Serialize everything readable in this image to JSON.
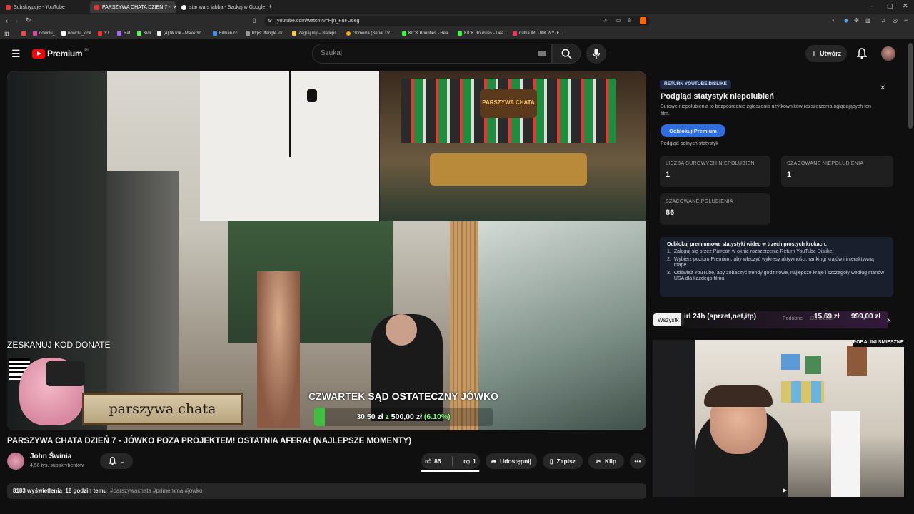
{
  "browser": {
    "tabs": [
      {
        "label": "Subskrypcje - YouTube",
        "active": false
      },
      {
        "label": "PARSZYWA CHATA DZIEŃ 7 -",
        "active": true
      },
      {
        "label": "star wars jabba - Szukaj w Google",
        "active": false
      }
    ],
    "url": "youtube.com/watch?v=Hjn_FuFU6eg",
    "bookmarks": [
      "nowciu_",
      "nowciu_kick",
      "YT",
      "Rat",
      "Kick",
      "(4)TikTok - Make Yo...",
      "Filman.cc",
      "https://tangle.io/",
      "Zagraj.my – Najleps...",
      "Gomorra (Serial TV...",
      "KICK Bounties - Hea...",
      "KICK Bounties - Dea...",
      "nutka IRL JAK WYJE..."
    ]
  },
  "header": {
    "logo_text": "Premium",
    "region": "PL",
    "search_placeholder": "Szukaj",
    "create_label": "Utwórz"
  },
  "video": {
    "overlay_qr_text": "ZESKANUJ KOD DONATE",
    "sign_text": "parszywa chata",
    "caption": "CZWARTEK SĄD OSTATECZNY JÓWKO",
    "donation_current": "30,50 zł",
    "donation_sep": "z",
    "donation_goal": "500,00 zł",
    "donation_pct": "(6.10%)",
    "progress_fraction": 0.061,
    "poster_text": "PARSZYWA CHATA"
  },
  "title": "PARSZYWA CHATA DZIEŃ 7 - JÓWKO POZA PROJEKTEM! OSTATNIA AFERA! (NAJLEPSZE MOMENTY)",
  "channel": {
    "name": "John Świnia",
    "subs": "4,56 tys. subskrybentów"
  },
  "actions": {
    "likes": "85",
    "dislikes": "1",
    "share": "Udostępnij",
    "save": "Zapisz",
    "clip": "Klip"
  },
  "description": {
    "views": "8183 wyświetlenia",
    "time": "18 godzin temu",
    "tags": "#parszywachata #primemma #jówko"
  },
  "panel": {
    "badge": "RETURN YOUTUBE DISLIKE",
    "heading": "Podgląd statystyk niepolubień",
    "subtext": "Surowe niepolubienia to bezpośrednie zgłoszenia użytkowników rozszerzenia oglądających ten film.",
    "unlock_button": "Odblokuj Premium",
    "full_stats_link": "Podgląd pełnych statystyk",
    "stats": [
      {
        "label": "LICZBA SUROWYCH NIEPOLUBIEŃ",
        "value": "1"
      },
      {
        "label": "SZACOWANE NIEPOLUBIENIA",
        "value": "1"
      },
      {
        "label": "SZACOWANE POLUBIENIA",
        "value": "86"
      }
    ],
    "promo_heading": "Odblokuj premiumowe statystyki wideo w trzech prostych krokach:",
    "promo_steps": [
      "Zaloguj się przez Patreon w oknie rozszerzenia Return YouTube Dislike.",
      "Wybierz poziom Premium, aby włączyć wykresy aktywności, rankingi krajów i interaktywną mapę.",
      "Odśwież YouTube, aby zobaczyć trendy godzinowe, najlepsze kraje i szczegóły według stanów USA dla każdego filmu."
    ]
  },
  "chips": {
    "first": "Wszystk",
    "overlay_text": "irl 24h (sprzet,net,itp)",
    "right_a": "Podobne",
    "right_b": "Dla Ciebie",
    "amount": "15,69 zł",
    "amount_goal": "999,00 zł",
    "cam_banner": "POBALINI ŚMIESZNE"
  }
}
